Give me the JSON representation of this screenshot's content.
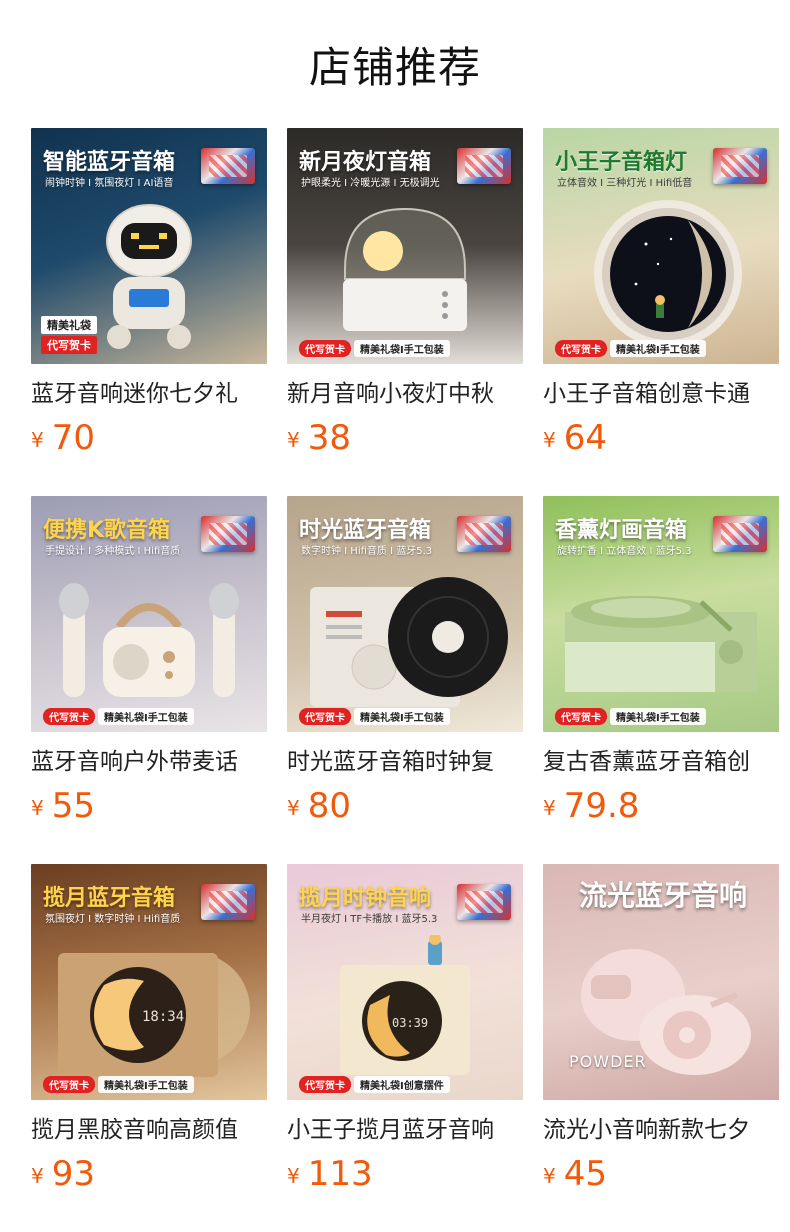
{
  "page": {
    "title": "店铺推荐"
  },
  "currency_symbol": "¥",
  "accent_price_color": "#f05a0a",
  "products": [
    {
      "name": "蓝牙音响迷你七夕礼",
      "price": "70",
      "image": {
        "headline": "智能蓝牙音箱",
        "subline": "闹钟时钟 I 氛围夜灯 I AI语音",
        "tags": [
          "精美礼袋",
          "代写贺卡"
        ]
      }
    },
    {
      "name": "新月音响小夜灯中秋",
      "price": "38",
      "image": {
        "headline": "新月夜灯音箱",
        "subline": "护眼柔光 I 冷暖光源 I 无极调光",
        "tags": [
          "代写贺卡",
          "精美礼袋I手工包装"
        ]
      }
    },
    {
      "name": "小王子音箱创意卡通",
      "price": "64",
      "image": {
        "headline": "小王子音箱灯",
        "subline": "立体音效 I 三种灯光 I Hifi低音",
        "tags": [
          "代写贺卡",
          "精美礼袋I手工包装"
        ]
      }
    },
    {
      "name": "蓝牙音响户外带麦话",
      "price": "55",
      "image": {
        "headline": "便携K歌音箱",
        "subline": "手提设计 I 多种模式 I Hifi音质",
        "tags": [
          "代写贺卡",
          "精美礼袋I手工包装"
        ]
      }
    },
    {
      "name": "时光蓝牙音箱时钟复",
      "price": "80",
      "image": {
        "headline": "时光蓝牙音箱",
        "subline": "数字时钟 I Hifi音质 I 蓝牙5.3",
        "tags": [
          "代写贺卡",
          "精美礼袋I手工包装"
        ]
      }
    },
    {
      "name": "复古香薰蓝牙音箱创",
      "price": "79.8",
      "image": {
        "headline": "香薰灯画音箱",
        "subline": "旋转扩香 I 立体音效 I 蓝牙5.3",
        "tags": [
          "代写贺卡",
          "精美礼袋I手工包装"
        ]
      }
    },
    {
      "name": "揽月黑胶音响高颜值",
      "price": "93",
      "image": {
        "headline": "揽月蓝牙音箱",
        "subline": "氛围夜灯 I 数字时钟 I Hifi音质",
        "tags": [
          "代写贺卡",
          "精美礼袋I手工包装"
        ]
      }
    },
    {
      "name": "小王子揽月蓝牙音响",
      "price": "113",
      "image": {
        "headline": "揽月时钟音响",
        "subline": "半月夜灯 I TF卡播放 I 蓝牙5.3",
        "tags": [
          "代写贺卡",
          "精美礼袋I创意摆件"
        ]
      }
    },
    {
      "name": "流光小音响新款七夕",
      "price": "45",
      "image": {
        "headline": "流光蓝牙音响",
        "subline": "",
        "brand_mark": "POWDER",
        "tags": []
      }
    }
  ]
}
